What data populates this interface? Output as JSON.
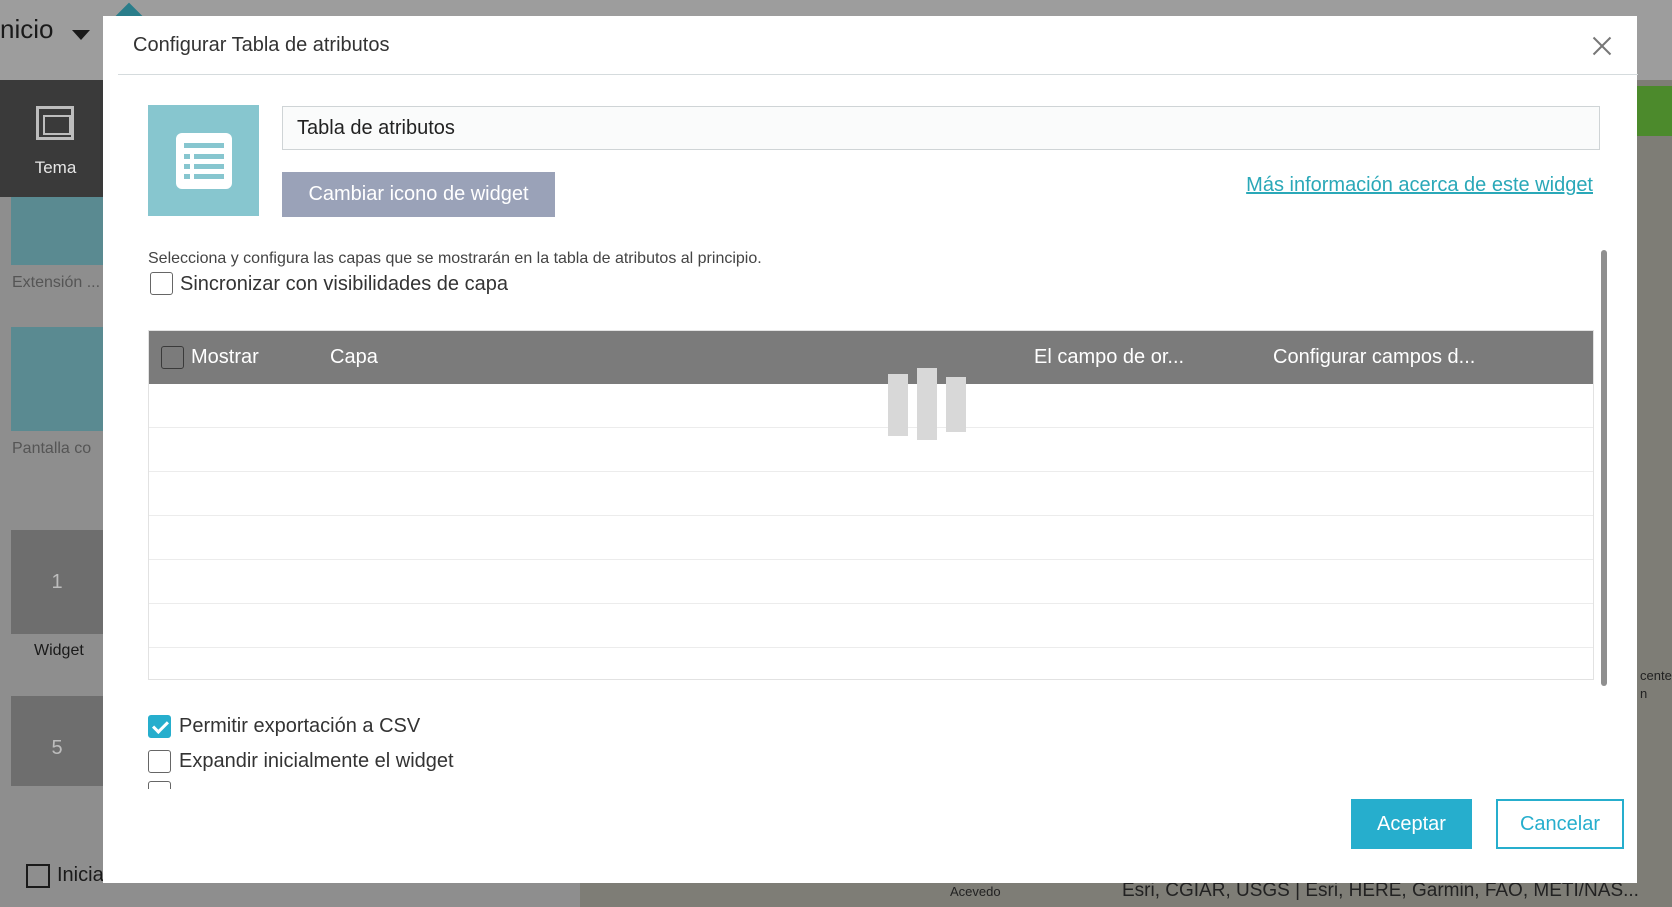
{
  "background": {
    "home_label": "nicio",
    "tema_label": "Tema",
    "tiles": [
      {
        "label": "Extensión ..."
      },
      {
        "label": "Pantalla co"
      }
    ],
    "numbered_tiles": [
      {
        "number": "1",
        "label": "Widget"
      },
      {
        "number": "5"
      }
    ],
    "launch_label": "Inicia",
    "map_labels": [
      "Acevedo",
      "cente",
      "n"
    ],
    "attribution": "Esri, CGIAR, USGS | Esri, HERE, Garmin, FAO, METI/NAS..."
  },
  "dialog": {
    "title": "Configurar Tabla de atributos",
    "widget_name_value": "Tabla de atributos",
    "change_icon_label": "Cambiar icono de widget",
    "more_info_link": "Más información acerca de este widget",
    "description": "Selecciona y configura las capas que se mostrarán en la tabla de atributos al principio.",
    "sync_checkbox": {
      "label": "Sincronizar con visibilidades de capa",
      "checked": false
    },
    "table": {
      "columns": [
        "Mostrar",
        "Capa",
        "El campo de or...",
        "Configurar campos d..."
      ],
      "rows": [],
      "loading": true
    },
    "options": [
      {
        "label": "Permitir exportación a CSV",
        "checked": true
      },
      {
        "label": "Expandir inicialmente el widget",
        "checked": false
      }
    ],
    "accept_label": "Aceptar",
    "cancel_label": "Cancelar"
  },
  "colors": {
    "accent": "#26aecd",
    "icon_tile": "#87c6cf",
    "table_header": "#7b7b7b",
    "link": "#2aa8b8"
  }
}
